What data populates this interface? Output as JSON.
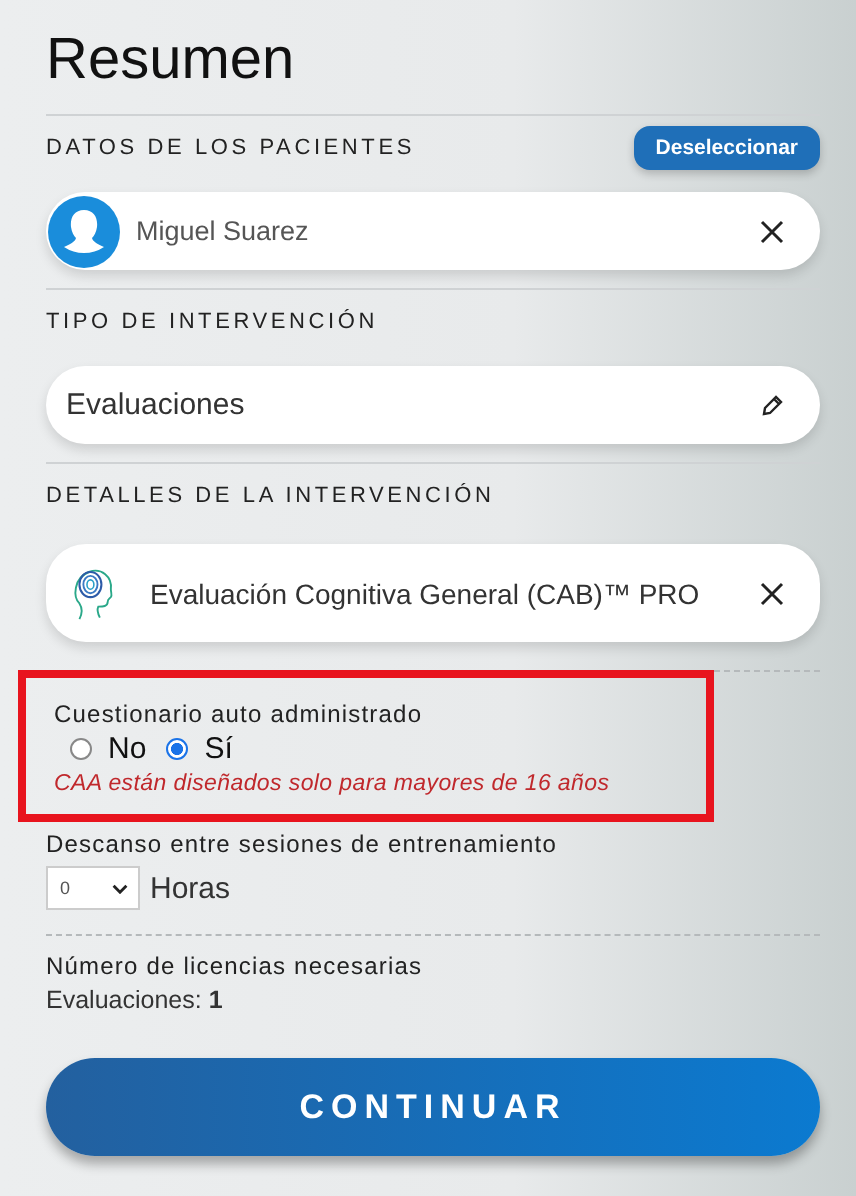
{
  "title": "Resumen",
  "patients": {
    "label": "DATOS DE LOS PACIENTES",
    "action": "Deseleccionar",
    "items": [
      {
        "name": "Miguel Suarez"
      }
    ]
  },
  "intervention_type": {
    "label": "TIPO DE INTERVENCIÓN",
    "value": "Evaluaciones"
  },
  "intervention_details": {
    "label": "DETALLES DE LA INTERVENCIÓN",
    "items": [
      {
        "name": "Evaluación Cognitiva General (CAB)™ PRO"
      }
    ]
  },
  "self_administered": {
    "label": "Cuestionario auto administrado",
    "highlighted": true,
    "options": [
      {
        "label": "No",
        "selected": false
      },
      {
        "label": "Sí",
        "selected": true
      }
    ],
    "warning": "CAA están diseñados solo para mayores de 16 años"
  },
  "rest": {
    "label": "Descanso entre sesiones de entrenamiento",
    "value": "0",
    "unit": "Horas"
  },
  "licenses": {
    "label": "Número de licencias necesarias",
    "line": "Evaluaciones: **1**"
  },
  "continue_button": "CONTINUAR"
}
